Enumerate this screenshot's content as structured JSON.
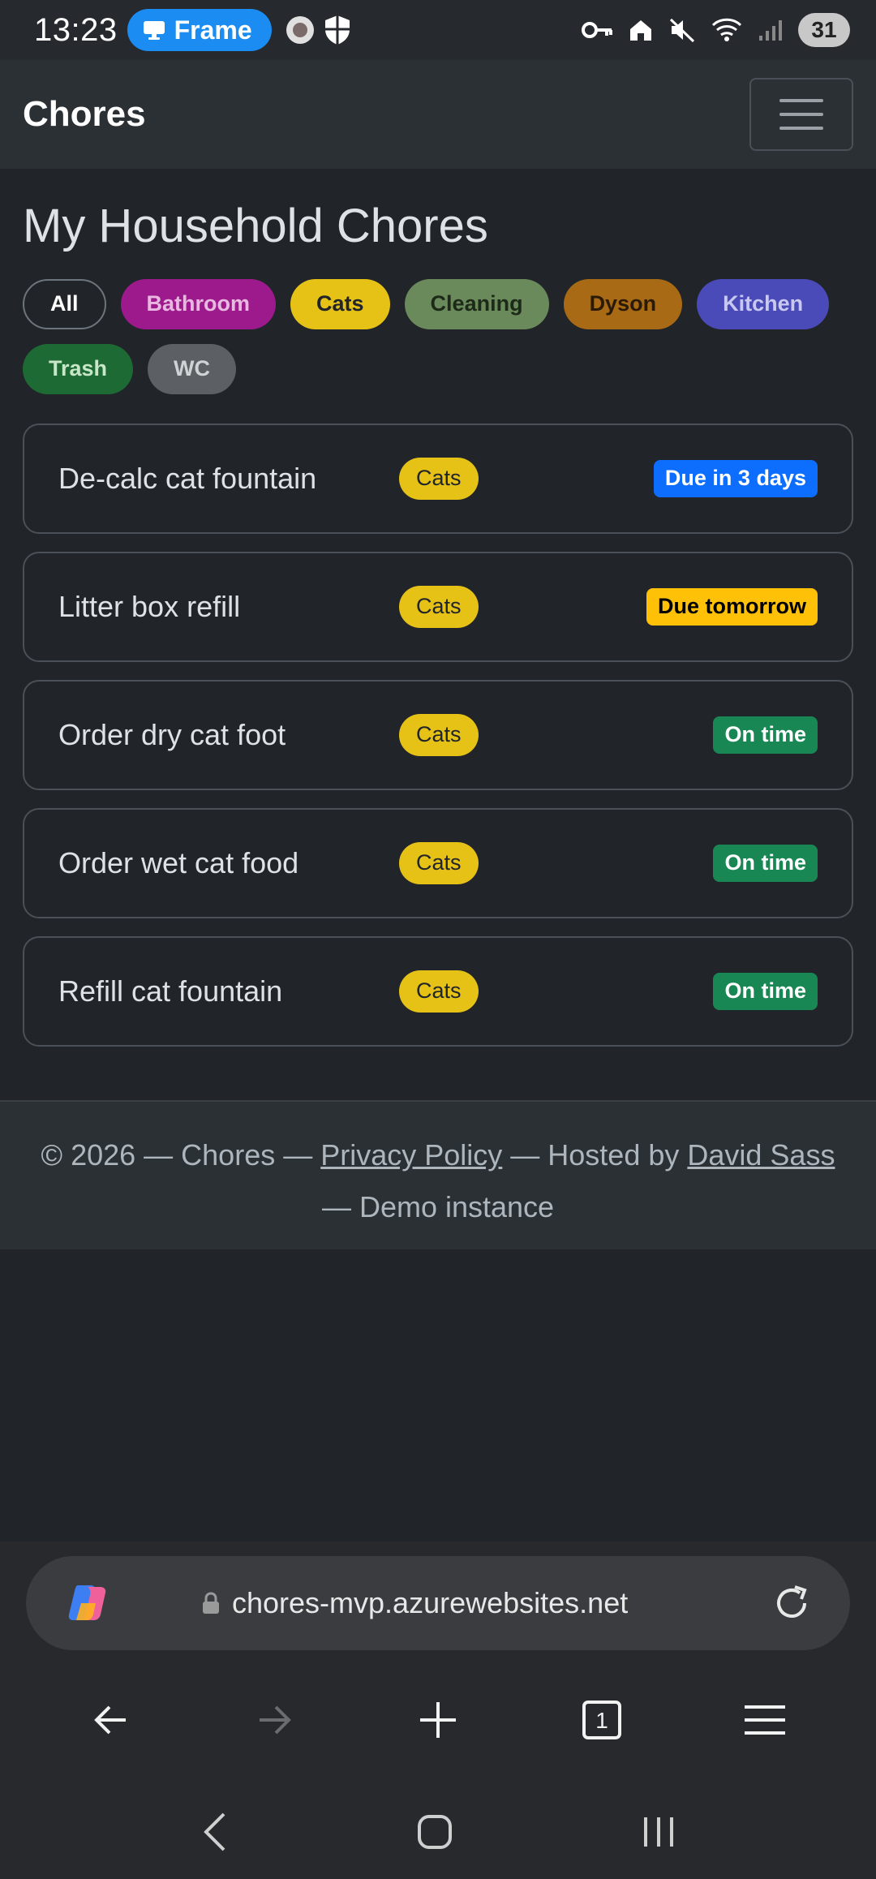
{
  "status_bar": {
    "time": "13:23",
    "pill_label": "Frame",
    "battery": "31"
  },
  "navbar": {
    "brand": "Chores",
    "menu_icon": "hamburger-icon"
  },
  "main": {
    "title": "My Household Chores",
    "filters": [
      {
        "label": "All",
        "bg": "transparent",
        "fg": "#ffffff"
      },
      {
        "label": "Bathroom",
        "bg": "#9c1a8c",
        "fg": "#e8b8e0"
      },
      {
        "label": "Cats",
        "bg": "#e6c217",
        "fg": "#212529"
      },
      {
        "label": "Cleaning",
        "bg": "#6a8a5c",
        "fg": "#1d2a18"
      },
      {
        "label": "Dyson",
        "bg": "#a86a14",
        "fg": "#2b1a05"
      },
      {
        "label": "Kitchen",
        "bg": "#4a4ab8",
        "fg": "#c8c8f0"
      },
      {
        "label": "Trash",
        "bg": "#1e6a34",
        "fg": "#c8e6c8"
      },
      {
        "label": "WC",
        "bg": "#5c5f63",
        "fg": "#d0d3d6"
      }
    ],
    "chores": [
      {
        "name": "De-calc cat fountain",
        "category": "Cats",
        "status": "Due in 3 days",
        "status_bg": "#0d6efd",
        "status_fg": "#ffffff"
      },
      {
        "name": "Litter box refill",
        "category": "Cats",
        "status": "Due tomorrow",
        "status_bg": "#ffc107",
        "status_fg": "#000000"
      },
      {
        "name": "Order dry cat foot",
        "category": "Cats",
        "status": "On time",
        "status_bg": "#198754",
        "status_fg": "#ffffff"
      },
      {
        "name": "Order wet cat food",
        "category": "Cats",
        "status": "On time",
        "status_bg": "#198754",
        "status_fg": "#ffffff"
      },
      {
        "name": "Refill cat fountain",
        "category": "Cats",
        "status": "On time",
        "status_bg": "#198754",
        "status_fg": "#ffffff"
      }
    ]
  },
  "footer": {
    "prefix": "© 2026 — Chores — ",
    "privacy_link": "Privacy Policy",
    "hosted": " — Hosted by ",
    "author_link": "David Sass",
    "suffix": "— Demo instance"
  },
  "browser": {
    "url": "chores-mvp.azurewebsites.net",
    "tab_count": "1"
  }
}
